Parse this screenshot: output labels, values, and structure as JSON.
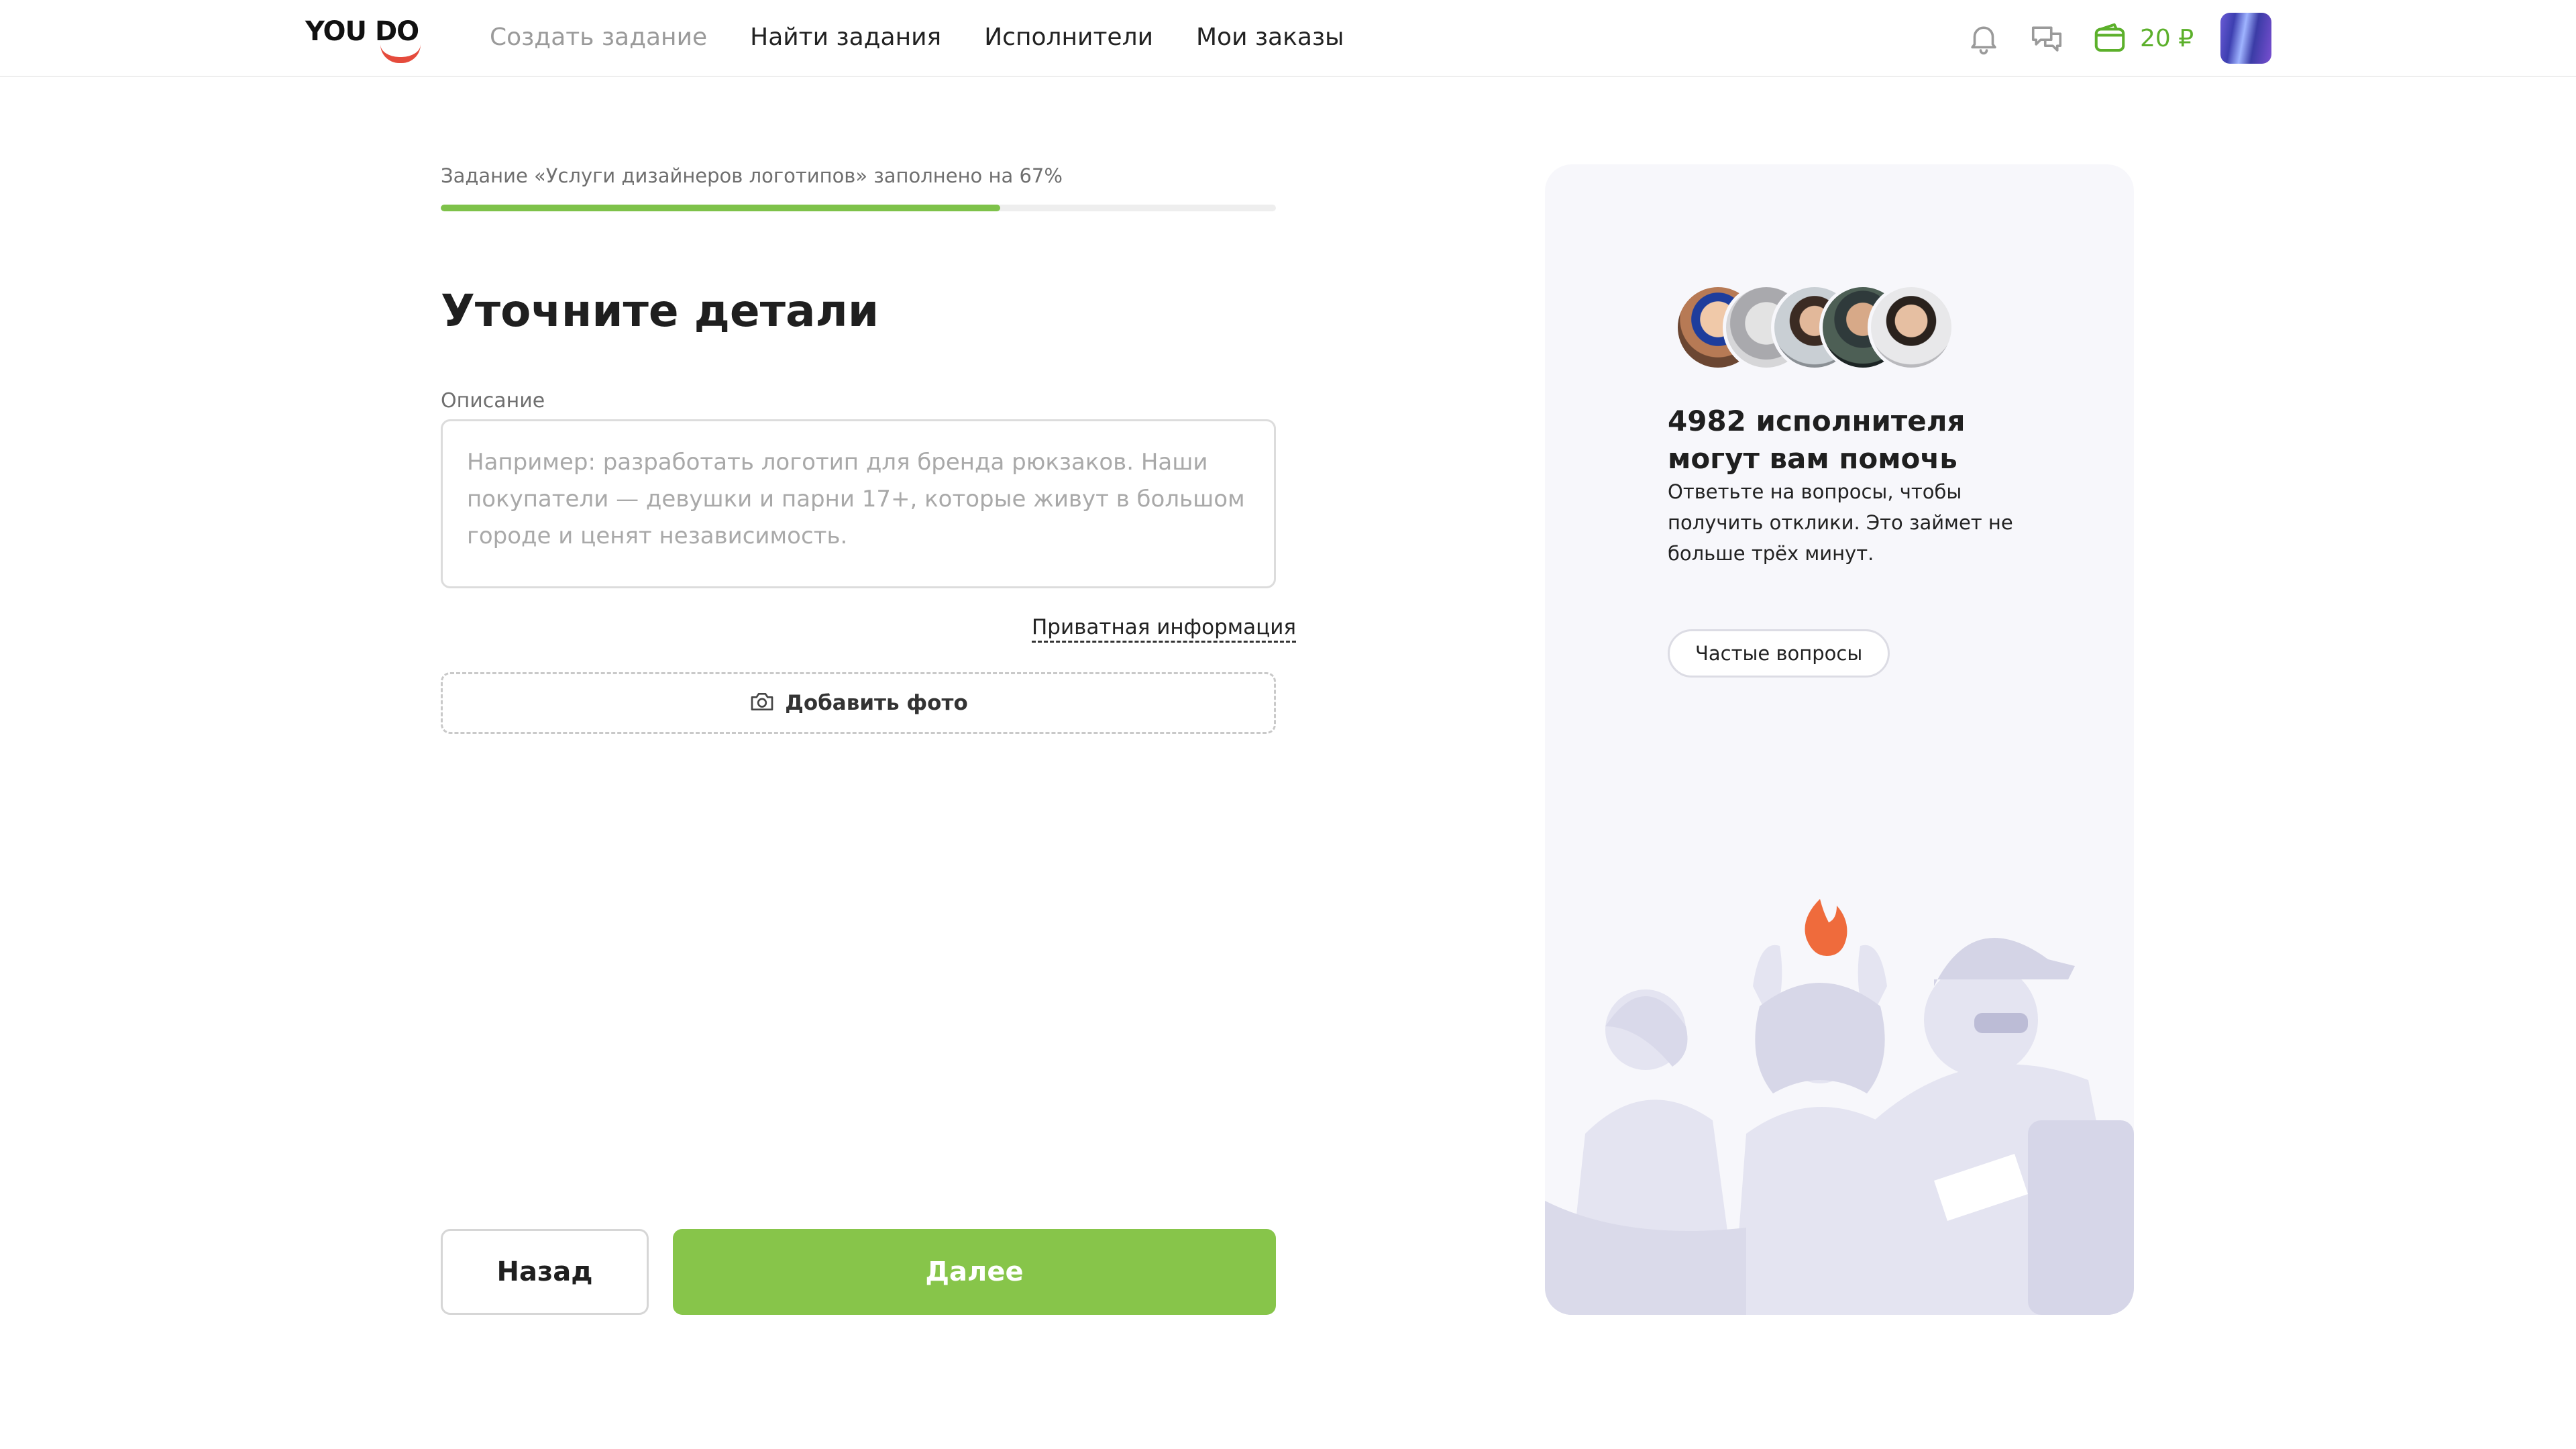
{
  "header": {
    "logo": "YOU DO",
    "nav": [
      {
        "label": "Создать задание",
        "muted": true
      },
      {
        "label": "Найти задания",
        "muted": false
      },
      {
        "label": "Исполнители",
        "muted": false
      },
      {
        "label": "Мои заказы",
        "muted": false
      }
    ],
    "balance": "20 ₽",
    "icons": [
      "bell-icon",
      "chat-icon",
      "wallet-icon"
    ],
    "accent_color": "#5cb02b"
  },
  "form": {
    "progress_text": "Задание «Услуги дизайнеров логотипов» заполнено на 67%",
    "progress_value": 0.67,
    "title": "Уточните детали",
    "description_label": "Описание",
    "description_value": "",
    "description_placeholder": "Например: разработать логотип для бренда рюкзаков. Наши покупатели — девушки и парни 17+, которые живут в большом городе и ценят независимость.",
    "private_link": "Приватная информация",
    "add_photo_label": "Добавить фото",
    "back_label": "Назад",
    "next_label": "Далее",
    "next_color": "#87c54a"
  },
  "side": {
    "title": "4982 исполнителя могут вам помочь",
    "text": "Ответьте на вопросы, чтобы получить отклики. Это займет не больше трёх минут.",
    "faq_label": "Частые вопросы",
    "avatar_count": 5
  }
}
